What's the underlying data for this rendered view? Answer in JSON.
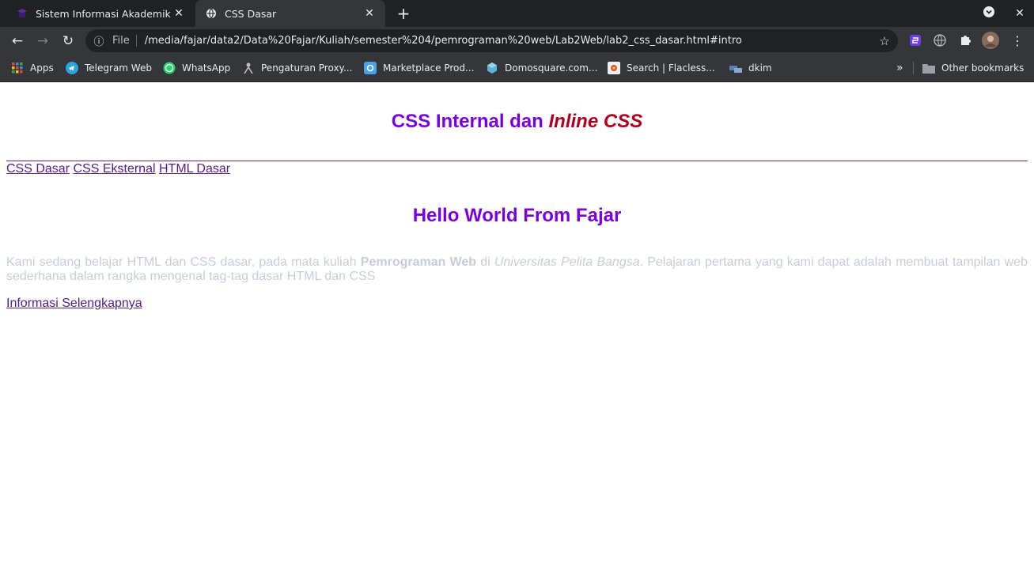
{
  "browser": {
    "tabs": [
      {
        "title": "Sistem Informasi Akademik",
        "active": false,
        "favicon": "graduation-icon"
      },
      {
        "title": "CSS Dasar",
        "active": true,
        "favicon": "globe-icon"
      }
    ],
    "address": {
      "scheme_label": "File",
      "url": "/media/fajar/data2/Data%20Fajar/Kuliah/semester%204/pemrograman%20web/Lab2Web/lab2_css_dasar.html#intro"
    },
    "bookmarks": [
      {
        "label": "Apps",
        "icon": "apps-grid-icon"
      },
      {
        "label": "Telegram Web",
        "icon": "telegram-icon"
      },
      {
        "label": "WhatsApp",
        "icon": "whatsapp-icon"
      },
      {
        "label": "Pengaturan Proxy...",
        "icon": "proxy-icon"
      },
      {
        "label": "Marketplace Prod...",
        "icon": "marketplace-icon"
      },
      {
        "label": "Domosquare.com...",
        "icon": "domosquare-icon"
      },
      {
        "label": "Search | Flacless...",
        "icon": "search-site-icon"
      },
      {
        "label": "dkim",
        "icon": "dkim-icon"
      }
    ],
    "other_bookmarks": "Other bookmarks"
  },
  "page": {
    "heading_part1": "CSS Internal dan",
    "heading_part2": "Inline CSS",
    "nav": [
      "CSS Dasar",
      "CSS Eksternal",
      "HTML Dasar"
    ],
    "subheading": "Hello World From Fajar",
    "intro_before": "Kami sedang belajar HTML dan CSS dasar, pada mata kuliah",
    "intro_bold": "Pemrograman Web",
    "intro_mid": "di",
    "intro_italic": "Universitas Pelita Bangsa",
    "intro_after": ". Pelajaran pertama yang kami dapat adalah membuat tampilan web sederhana dalam rangka mengenal tag-tag dasar HTML dan CSS",
    "more_link": "Informasi Selengkapnya"
  },
  "colors": {
    "heading": "#7b00e0",
    "heading_italic": "#b00020",
    "intro_text": "#c5cdd8",
    "link": "#551a8b"
  }
}
